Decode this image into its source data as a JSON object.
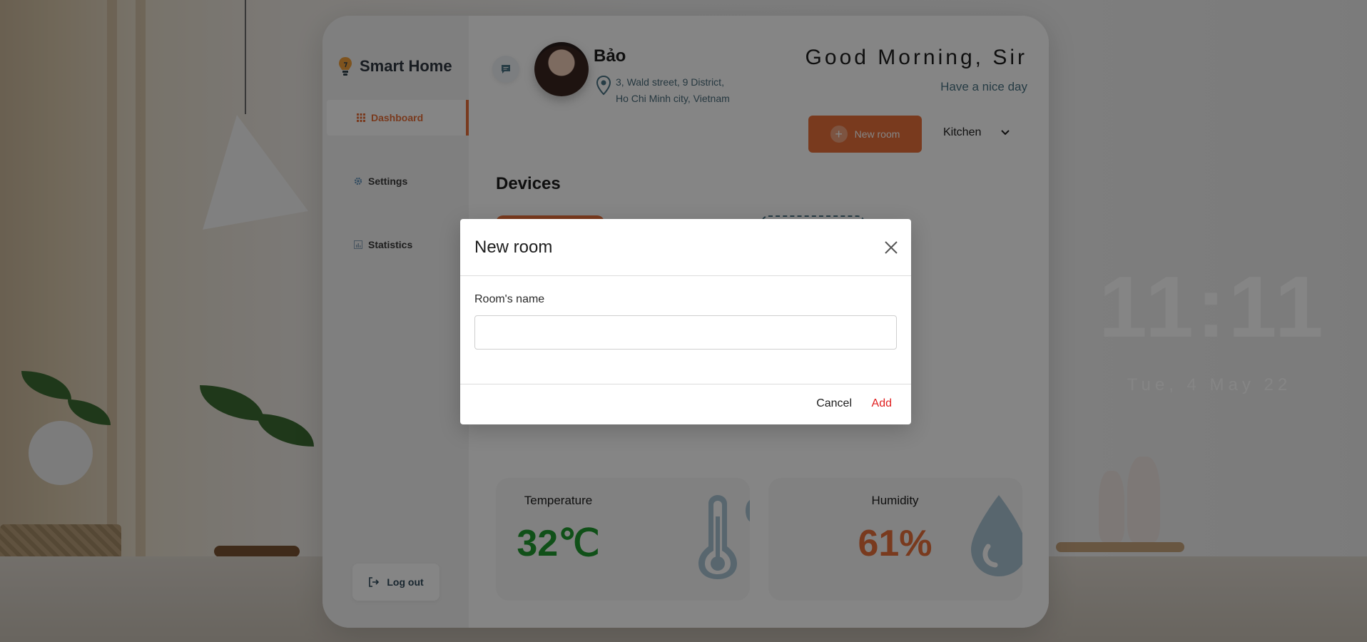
{
  "sidebar": {
    "app_name": "Smart Home",
    "items": [
      {
        "label": "Dashboard",
        "icon": "grid-icon"
      },
      {
        "label": "Settings",
        "icon": "gear-icon"
      },
      {
        "label": "Statistics",
        "icon": "chart-icon"
      }
    ],
    "logout_label": "Log out"
  },
  "header": {
    "user_name": "Bảo",
    "address_line1": "3, Wald street, 9 District,",
    "address_line2": "Ho Chi Minh city, Vietnam",
    "greeting": "Good Morning, Sir",
    "sub_greeting": "Have a nice day",
    "new_room_label": "New room",
    "room_selected": "Kitchen"
  },
  "devices": {
    "title": "Devices"
  },
  "stats": [
    {
      "label": "Temperature",
      "value": "32℃",
      "color": "#1f9a2e",
      "icon": "thermometer-icon"
    },
    {
      "label": "Humidity",
      "value": "61%",
      "color": "#e8703a",
      "icon": "water-drop-icon"
    }
  ],
  "clock": {
    "time": "11:11",
    "date": "Tue, 4 May 22"
  },
  "modal": {
    "title": "New room",
    "field_label": "Room's name",
    "field_value": "",
    "cancel_label": "Cancel",
    "add_label": "Add"
  },
  "colors": {
    "accent": "#e8703a",
    "danger": "#e02020",
    "temperature": "#1f9a2e"
  }
}
